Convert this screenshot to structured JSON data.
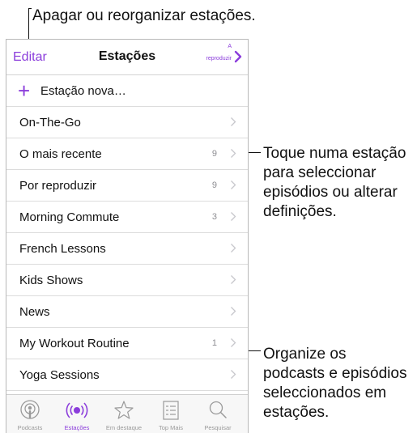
{
  "callouts": {
    "top": "Apagar ou reorganizar estações.",
    "middle": [
      "Toque numa estação",
      "para seleccionar",
      "episódios ou alterar",
      "definições."
    ],
    "bottom": [
      "Organize os",
      "podcasts e episódios",
      "seleccionados em",
      "estações."
    ]
  },
  "navbar": {
    "edit_label": "Editar",
    "title": "Estações",
    "right_label": "reproduzir",
    "right_sup": "A"
  },
  "new_station": {
    "label": "Estação nova…",
    "icon": "plus-icon"
  },
  "stations": [
    {
      "label": "On-The-Go",
      "count": ""
    },
    {
      "label": "O mais recente",
      "count": "9"
    },
    {
      "label": "Por reproduzir",
      "count": "9"
    },
    {
      "label": "Morning Commute",
      "count": "3"
    },
    {
      "label": "French Lessons",
      "count": ""
    },
    {
      "label": "Kids Shows",
      "count": ""
    },
    {
      "label": "News",
      "count": ""
    },
    {
      "label": "My Workout Routine",
      "count": "1"
    },
    {
      "label": "Yoga Sessions",
      "count": ""
    }
  ],
  "tabs": [
    {
      "label": "Podcasts",
      "icon": "podcasts-icon",
      "active": false
    },
    {
      "label": "Estações",
      "icon": "stations-icon",
      "active": true
    },
    {
      "label": "Em destaque",
      "icon": "star-icon",
      "active": false
    },
    {
      "label": "Top Mais",
      "icon": "list-icon",
      "active": false
    },
    {
      "label": "Pesquisar",
      "icon": "search-icon",
      "active": false
    }
  ],
  "colors": {
    "accent": "#8b3ddb",
    "chevron": "#c7c7cc",
    "count": "#8e8e93"
  }
}
